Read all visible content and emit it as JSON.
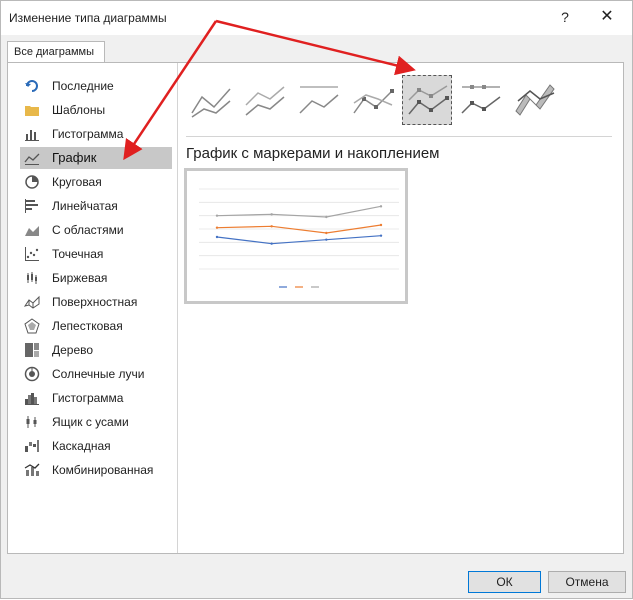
{
  "window": {
    "title": "Изменение типа диаграммы",
    "help": "?",
    "close": "✕"
  },
  "tab": {
    "label": "Все диаграммы"
  },
  "sidebar": {
    "items": [
      {
        "label": "Последние",
        "icon": "recent-icon"
      },
      {
        "label": "Шаблоны",
        "icon": "folder-icon"
      },
      {
        "label": "Гистограмма",
        "icon": "column-chart-icon"
      },
      {
        "label": "График",
        "icon": "line-chart-icon",
        "selected": true
      },
      {
        "label": "Круговая",
        "icon": "pie-chart-icon"
      },
      {
        "label": "Линейчатая",
        "icon": "bar-chart-icon"
      },
      {
        "label": "С областями",
        "icon": "area-chart-icon"
      },
      {
        "label": "Точечная",
        "icon": "scatter-chart-icon"
      },
      {
        "label": "Биржевая",
        "icon": "stock-chart-icon"
      },
      {
        "label": "Поверхностная",
        "icon": "surface-chart-icon"
      },
      {
        "label": "Лепестковая",
        "icon": "radar-chart-icon"
      },
      {
        "label": "Дерево",
        "icon": "treemap-icon"
      },
      {
        "label": "Солнечные лучи",
        "icon": "sunburst-icon"
      },
      {
        "label": "Гистограмма",
        "icon": "histogram-icon"
      },
      {
        "label": "Ящик с усами",
        "icon": "box-whisker-icon"
      },
      {
        "label": "Каскадная",
        "icon": "waterfall-icon"
      },
      {
        "label": "Комбинированная",
        "icon": "combo-chart-icon"
      }
    ]
  },
  "subtypes": {
    "selected_index": 4,
    "items": [
      "line",
      "stacked-line",
      "percent-stacked-line",
      "line-with-markers",
      "stacked-line-with-markers",
      "percent-stacked-line-with-markers",
      "3d-line"
    ]
  },
  "main": {
    "heading": "График с маркерами и накоплением"
  },
  "preview_chart": {
    "type": "line",
    "categories": [
      "",
      "",
      "",
      ""
    ],
    "series": [
      {
        "color": "#4472c4",
        "values": [
          2.4,
          1.9,
          2.2,
          2.5
        ]
      },
      {
        "color": "#ed7d31",
        "values": [
          3.1,
          3.2,
          2.7,
          3.3
        ]
      },
      {
        "color": "#a5a5a5",
        "values": [
          4.0,
          4.1,
          3.9,
          4.7
        ]
      }
    ],
    "ylim": [
      0,
      6
    ]
  },
  "buttons": {
    "ok": "ОК",
    "cancel": "Отмена"
  },
  "colors": {
    "accent": "#0078d7",
    "arrow": "#e02020"
  }
}
